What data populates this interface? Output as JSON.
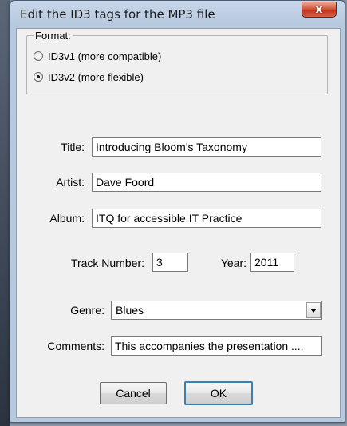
{
  "window": {
    "title": "Edit the ID3 tags for the MP3 file",
    "close_label": "x"
  },
  "format": {
    "legend": "Format:",
    "options": [
      {
        "label": "ID3v1 (more compatible)",
        "checked": false
      },
      {
        "label": "ID3v2 (more flexible)",
        "checked": true
      }
    ]
  },
  "fields": {
    "title": {
      "label": "Title:",
      "value": "Introducing Bloom's Taxonomy"
    },
    "artist": {
      "label": "Artist:",
      "value": "Dave Foord"
    },
    "album": {
      "label": "Album:",
      "value": "ITQ for accessible IT Practice"
    },
    "track_number": {
      "label": "Track Number:",
      "value": "3"
    },
    "year": {
      "label": "Year:",
      "value": "2011"
    },
    "genre": {
      "label": "Genre:",
      "value": "Blues"
    },
    "comments": {
      "label": "Comments:",
      "value": "This accompanies the presentation ...."
    }
  },
  "buttons": {
    "cancel": "Cancel",
    "ok": "OK"
  }
}
